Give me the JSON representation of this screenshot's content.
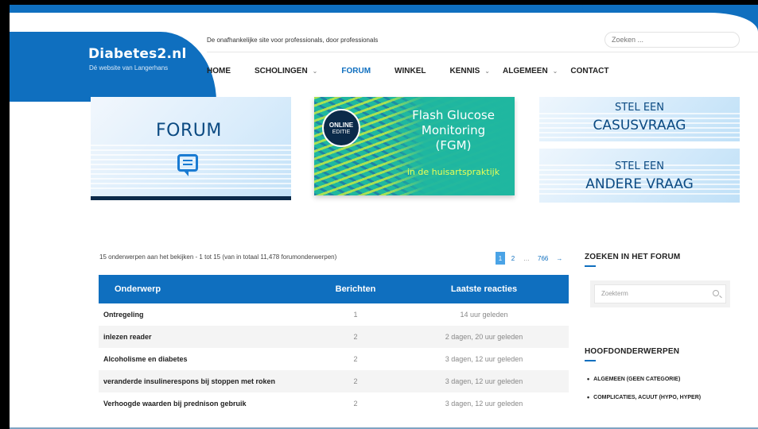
{
  "header": {
    "logo_title": "Diabetes2.nl",
    "logo_subtitle": "Dé website van Langerhans",
    "tagline": "De onafhankelijke site voor professionals, door professionals",
    "search_placeholder": "Zoeken ...",
    "nav": [
      {
        "label": "HOME",
        "dropdown": false,
        "active": false
      },
      {
        "label": "SCHOLINGEN",
        "dropdown": true,
        "active": false
      },
      {
        "label": "FORUM",
        "dropdown": false,
        "active": true
      },
      {
        "label": "WINKEL",
        "dropdown": false,
        "active": false
      },
      {
        "label": "KENNIS",
        "dropdown": true,
        "active": false
      },
      {
        "label": "ALGEMEEN",
        "dropdown": true,
        "active": false
      },
      {
        "label": "CONTACT",
        "dropdown": false,
        "active": false
      }
    ],
    "chevron": "⌄"
  },
  "banners": {
    "forum_title": "FORUM",
    "fgm_badge_top": "ONLINE",
    "fgm_badge_bottom": "EDITIE",
    "fgm_line1": "Flash Glucose",
    "fgm_line2": "Monitoring",
    "fgm_line3": "(FGM)",
    "fgm_sub": "in de huisartspraktijk",
    "case_line1": "STEL EEN",
    "case_line2": "CASUSVRAAG",
    "other_line1": "STEL EEN",
    "other_line2": "ANDERE VRAAG"
  },
  "listing": {
    "count_text": "15 onderwerpen aan het bekijken - 1 tot 15 (van in totaal 11,478 forumonderwerpen)",
    "pagination": [
      "1",
      "2",
      "…",
      "766",
      "→"
    ],
    "columns": [
      "Onderwerp",
      "Berichten",
      "Laatste reacties"
    ],
    "rows": [
      {
        "topic": "Ontregeling",
        "posts": "1",
        "last": "14 uur geleden"
      },
      {
        "topic": "inlezen reader",
        "posts": "2",
        "last": "2 dagen, 20 uur geleden"
      },
      {
        "topic": "Alcoholisme en diabetes",
        "posts": "2",
        "last": "3 dagen, 12 uur geleden"
      },
      {
        "topic": "veranderde insulinerespons bij stoppen met roken",
        "posts": "2",
        "last": "3 dagen, 12 uur geleden"
      },
      {
        "topic": "Verhoogde waarden bij prednison gebruik",
        "posts": "2",
        "last": "3 dagen, 12 uur geleden"
      }
    ]
  },
  "sidebar": {
    "search_heading": "ZOEKEN IN HET FORUM",
    "search_placeholder": "Zoekterm",
    "topics_heading": "HOOFDONDERWERPEN",
    "categories": [
      "ALGEMEEN (GEEN CATEGORIE)",
      "COMPLICATIES, ACUUT (HYPO, HYPER)"
    ]
  },
  "colors": {
    "brand_blue": "#0f6fbf",
    "pagination_active": "#4aa3e6",
    "dark_navy": "#0b2a4a"
  }
}
